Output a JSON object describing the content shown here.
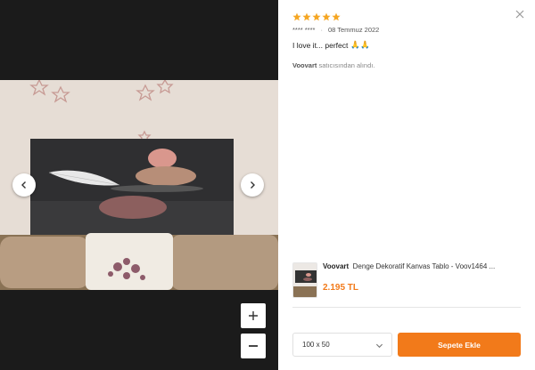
{
  "review": {
    "rating": 5,
    "max_rating": 5,
    "reviewer": "**** ****",
    "date": "08 Temmuz 2022",
    "text": "I love it... perfect",
    "emoji": "🙏🙏",
    "seller_name": "Voovart",
    "seller_suffix": "satıcısından alındı."
  },
  "product": {
    "brand": "Voovart",
    "title": "Denge Dekoratif Kanvas Tablo - Voov1464 ...",
    "price": "2.195 TL"
  },
  "size_select": {
    "value": "100 x 50"
  },
  "actions": {
    "add_to_cart": "Sepete Ekle"
  },
  "viewer": {
    "zoom_in_label": "+",
    "zoom_out_label": "−"
  },
  "colors": {
    "accent": "#f27a1a",
    "star": "#f5a623",
    "viewer_bg": "#1b1b1b"
  },
  "icons": [
    "star-icon",
    "close-icon",
    "chevron-left-icon",
    "chevron-right-icon",
    "plus-icon",
    "minus-icon",
    "chevron-down-icon"
  ]
}
